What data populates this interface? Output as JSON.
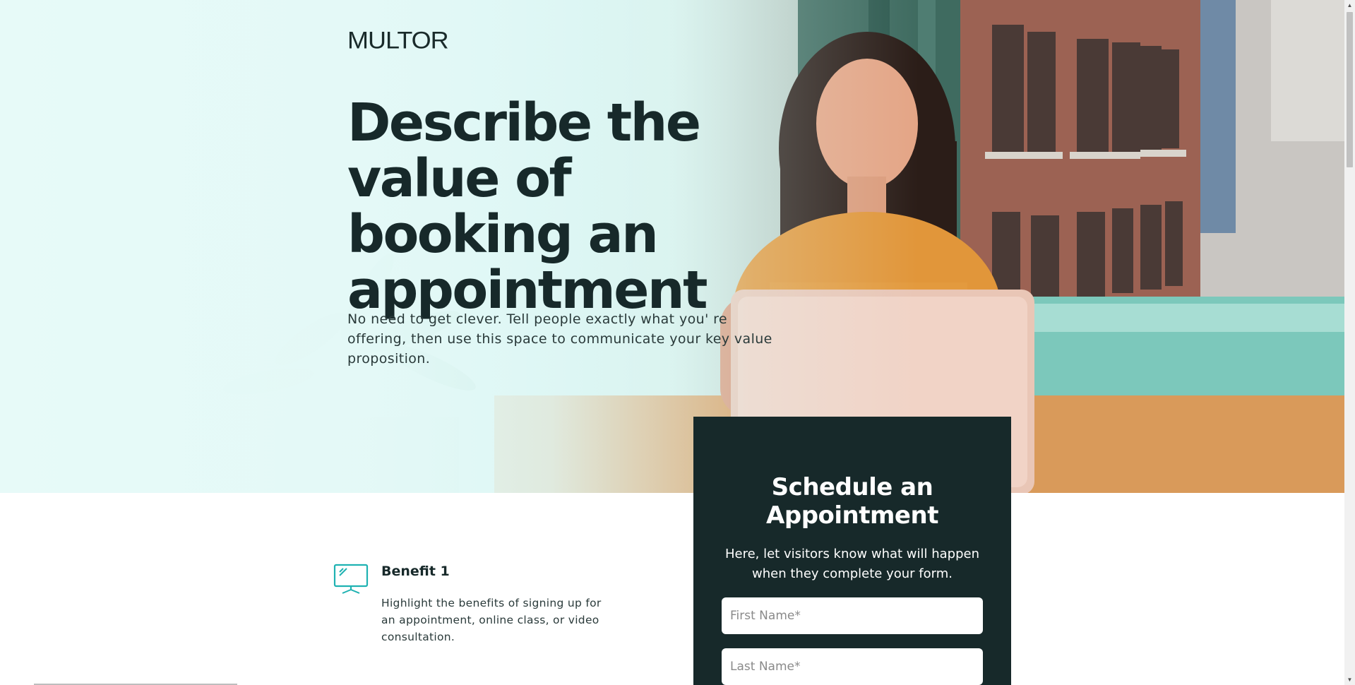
{
  "brand": {
    "logo_text": "MULTOR"
  },
  "hero": {
    "title": "Describe the value of booking an appointment",
    "subtitle": "No need to get clever. Tell people exactly what you' re offering, then use this space to communicate your key value proposition."
  },
  "form": {
    "title": "Schedule an Appointment",
    "description": "Here, let visitors know what will happen when they complete your form.",
    "first_name": {
      "placeholder": "First Name*",
      "value": ""
    },
    "last_name": {
      "placeholder": "Last Name*",
      "value": ""
    }
  },
  "benefits": [
    {
      "icon": "monitor-icon",
      "title": "Benefit 1",
      "text": "Highlight the benefits of signing up for an appointment, online class, or video consultation."
    }
  ],
  "colors": {
    "dark_teal": "#17292a",
    "accent_teal": "#1fb2b2",
    "hero_mint": "#e7faf8"
  }
}
